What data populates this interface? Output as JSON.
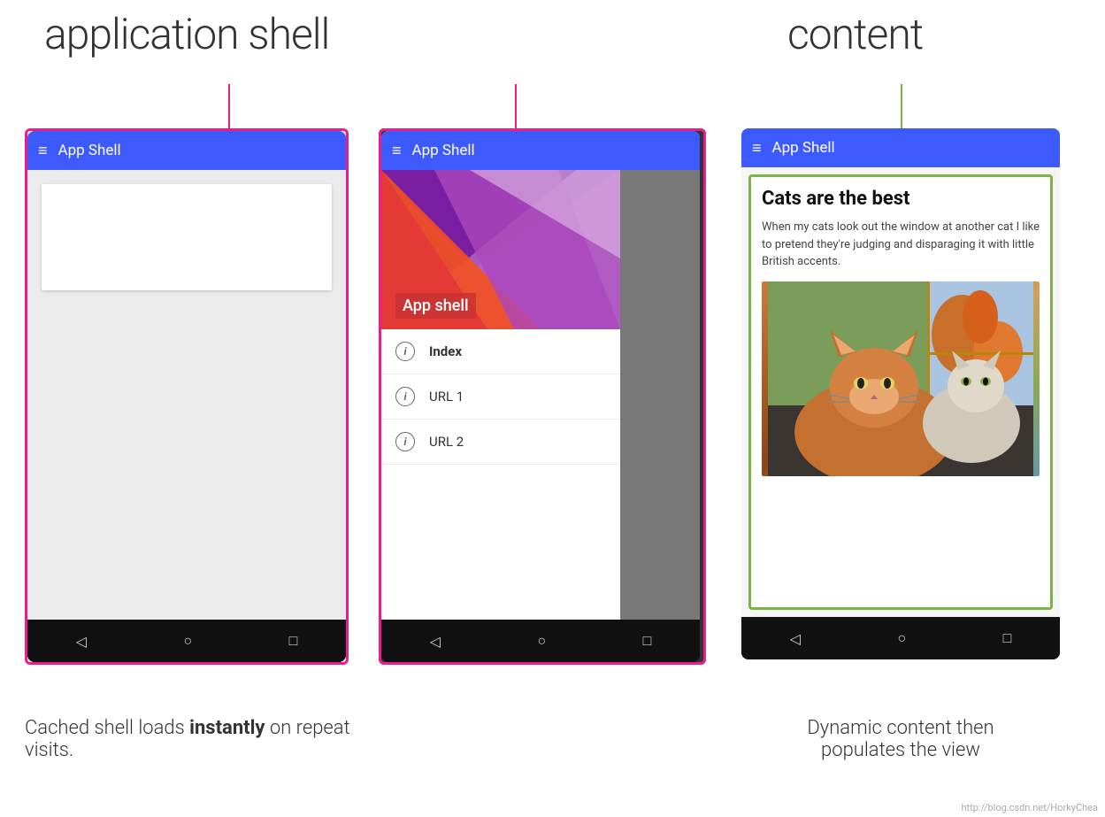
{
  "labels": {
    "app_shell": "application shell",
    "content": "content"
  },
  "phone1": {
    "app_bar_title": "App Shell",
    "hamburger": "≡"
  },
  "phone2": {
    "app_bar_title": "App Shell",
    "hamburger": "≡",
    "drawer_app_label": "App shell",
    "drawer_items": [
      {
        "label": "Index",
        "active": true
      },
      {
        "label": "URL 1",
        "active": false
      },
      {
        "label": "URL 2",
        "active": false
      }
    ]
  },
  "phone3": {
    "app_bar_title": "App Shell",
    "hamburger": "≡",
    "card_title": "Cats are the best",
    "card_text": "When my cats look out the window at another cat I like to pretend they're judging and disparaging it with little British accents."
  },
  "nav_buttons": [
    "◁",
    "○",
    "□"
  ],
  "captions": {
    "left": "Cached shell loads instantly on repeat visits.",
    "left_bold": "instantly",
    "right_line1": "Dynamic content then",
    "right_line2": "populates the view"
  },
  "watermark": "http://blog.csdn.net/HorkyChea"
}
